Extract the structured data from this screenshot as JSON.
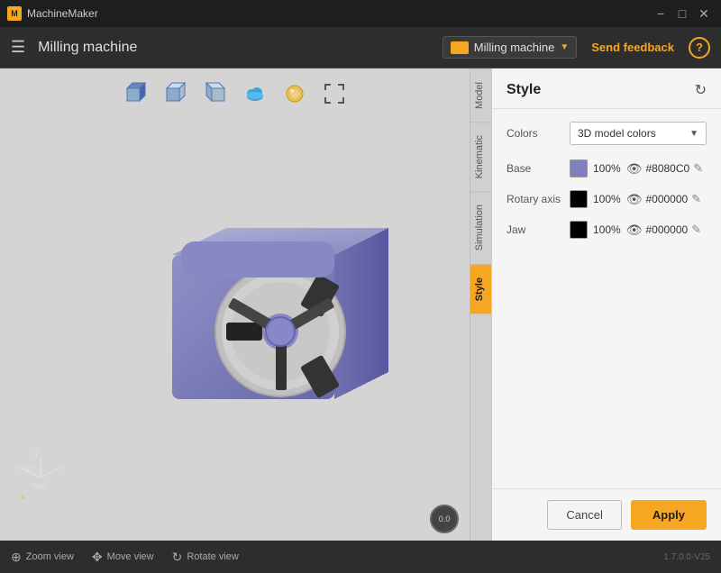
{
  "titleBar": {
    "appName": "MachineMaker",
    "controls": {
      "minimize": "−",
      "maximize": "□",
      "close": "✕"
    }
  },
  "header": {
    "menuIcon": "☰",
    "title": "Milling machine",
    "machineSelector": {
      "label": "Milling machine",
      "arrow": "▼"
    },
    "sendFeedback": "Send feedback",
    "helpIcon": "?"
  },
  "toolbar": {
    "items": [
      {
        "name": "perspective-view",
        "label": "Perspective"
      },
      {
        "name": "front-view",
        "label": "Front"
      },
      {
        "name": "back-view",
        "label": "Back"
      },
      {
        "name": "cloud-view",
        "label": "Cloud"
      },
      {
        "name": "camera-view",
        "label": "Camera"
      },
      {
        "name": "fit-view",
        "label": "Fit"
      }
    ]
  },
  "sideTabs": [
    {
      "name": "model",
      "label": "Model",
      "active": false
    },
    {
      "name": "kinematic",
      "label": "Kinematic",
      "active": false
    },
    {
      "name": "simulation",
      "label": "Simulation",
      "active": false
    },
    {
      "name": "style",
      "label": "Style",
      "active": true
    }
  ],
  "panel": {
    "title": "Style",
    "refreshIcon": "↻",
    "colorsLabel": "Colors",
    "colorsSelect": "3D model colors",
    "colorRows": [
      {
        "label": "Base",
        "swatchColor": "#8080C0",
        "percent": "100%",
        "hex": "#8080C0"
      },
      {
        "label": "Rotary axis",
        "swatchColor": "#000000",
        "percent": "100%",
        "hex": "#000000"
      },
      {
        "label": "Jaw",
        "swatchColor": "#000000",
        "percent": "100%",
        "hex": "#000000"
      }
    ]
  },
  "footer": {
    "cancelLabel": "Cancel",
    "applyLabel": "Apply"
  },
  "bottomBar": {
    "tools": [
      {
        "name": "zoom-view",
        "icon": "⊕",
        "label": "Zoom view"
      },
      {
        "name": "move-view",
        "icon": "✥",
        "label": "Move view"
      },
      {
        "name": "rotate-view",
        "icon": "↻",
        "label": "Rotate view"
      }
    ],
    "version": "1.7.0.0-V25"
  },
  "speedIndicator": "0.0"
}
